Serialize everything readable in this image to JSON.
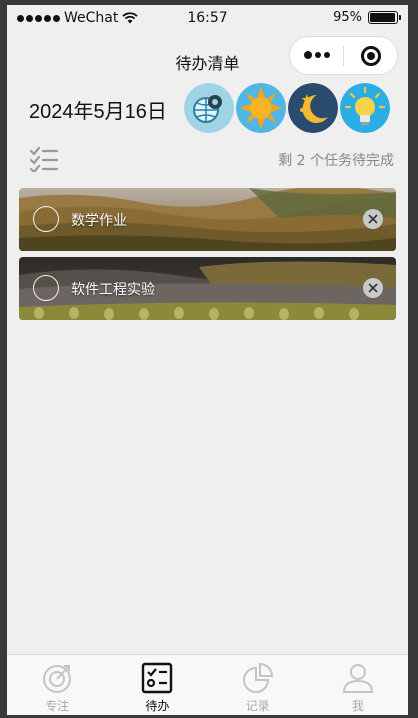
{
  "status_bar": {
    "carrier": "WeChat",
    "time": "16:57",
    "battery": "95%",
    "battery_level": 0.95
  },
  "nav": {
    "title": "待办清单"
  },
  "header": {
    "date": "2024年5月16日",
    "weather_icons": [
      "globe-gear-icon",
      "sun-icon",
      "moon-stars-icon",
      "lightbulb-icon"
    ]
  },
  "summary": {
    "remaining_text": "剩 2 个任务待完成"
  },
  "tasks": [
    {
      "label": "数学作业"
    },
    {
      "label": "软件工程实验"
    }
  ],
  "tabbar": {
    "items": [
      {
        "label": "专注",
        "icon": "focus-icon",
        "active": false
      },
      {
        "label": "待办",
        "icon": "todo-icon",
        "active": true
      },
      {
        "label": "记录",
        "icon": "pie-chart-icon",
        "active": false
      },
      {
        "label": "我",
        "icon": "user-icon",
        "active": false
      }
    ]
  },
  "colors": {
    "background": "#efefef",
    "text_primary": "#111111",
    "text_muted": "#888888",
    "tab_inactive": "#aaaaaa"
  }
}
